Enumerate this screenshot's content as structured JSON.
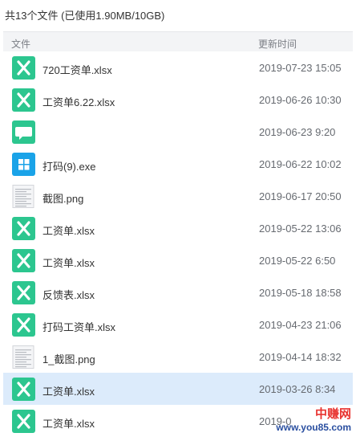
{
  "summary": "共13个文件 (已使用1.90MB/10GB)",
  "header": {
    "name_label": "文件",
    "time_label": "更新时间"
  },
  "colors": {
    "excel_icon": "#2cc68f",
    "chat_icon": "#2cc68f",
    "exe_icon": "#1aa3e8",
    "selected_row": "#dcebfb",
    "header_bg": "#f3f4f6"
  },
  "files": [
    {
      "name": "720工资单.xlsx",
      "time": "2019-07-23 15:05",
      "icon": "excel-icon"
    },
    {
      "name": "工资单6.22.xlsx",
      "time": "2019-06-26 10:30",
      "icon": "excel-icon"
    },
    {
      "name": "",
      "time": "2019-06-23 9:20",
      "icon": "chat-bubble-icon"
    },
    {
      "name": "打码(9).exe",
      "time": "2019-06-22 10:02",
      "icon": "windows-exe-icon"
    },
    {
      "name": "截图.png",
      "time": "2019-06-17 20:50",
      "icon": "image-thumbnail-icon"
    },
    {
      "name": "工资单.xlsx",
      "time": "2019-05-22 13:06",
      "icon": "excel-icon"
    },
    {
      "name": "工资单.xlsx",
      "time": "2019-05-22 6:50",
      "icon": "excel-icon"
    },
    {
      "name": "反馈表.xlsx",
      "time": "2019-05-18 18:58",
      "icon": "excel-icon"
    },
    {
      "name": "打码工资单.xlsx",
      "time": "2019-04-23 21:06",
      "icon": "excel-icon"
    },
    {
      "name": "1_截图.png",
      "time": "2019-04-14 18:32",
      "icon": "image-thumbnail-icon"
    },
    {
      "name": "工资单.xlsx",
      "time": "2019-03-26 8:34",
      "icon": "excel-icon",
      "selected": true
    },
    {
      "name": "工资单.xlsx",
      "time": "2019-0",
      "icon": "excel-icon"
    }
  ],
  "watermark": {
    "top": "中赚网",
    "bottom": "www.you85.com"
  }
}
